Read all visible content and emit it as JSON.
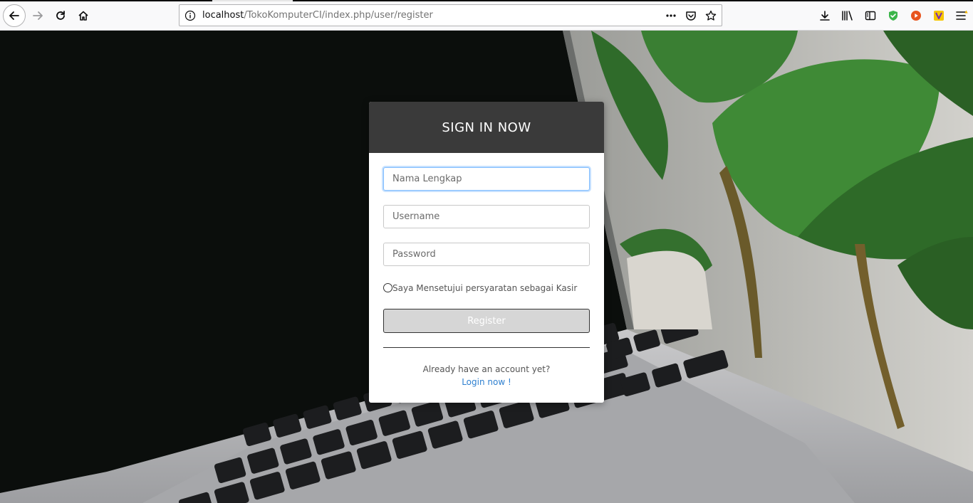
{
  "browser": {
    "url_host": "localhost",
    "url_path": "/TokoKomputerCI/index.php/user/register",
    "icons": {
      "back": "arrow-left-icon",
      "forward": "arrow-right-icon",
      "reload": "reload-icon",
      "home": "home-icon",
      "info": "info-icon",
      "page_actions": "more-horizontal-icon",
      "pocket": "pocket-icon",
      "bookmark": "star-icon",
      "downloads": "download-icon",
      "library": "library-icon",
      "sidebar": "sidebar-icon",
      "extensions": [
        "shield-extension-icon",
        "play-extension-icon",
        "v-extension-icon"
      ],
      "menu": "hamburger-menu-icon"
    }
  },
  "form": {
    "title": "SIGN IN NOW",
    "fields": {
      "fullname_placeholder": "Nama Lengkap",
      "username_placeholder": "Username",
      "password_placeholder": "Password"
    },
    "agree_label": "Saya Mensetujui persyaratan sebagai Kasir",
    "register_label": "Register",
    "footer_question": "Already have an account yet?",
    "login_link": "Login now !"
  },
  "colors": {
    "header_bg": "#3a3a3a",
    "link": "#2f80d0",
    "button_bg": "#d6d6d6",
    "focus_ring": "#80bdff"
  }
}
